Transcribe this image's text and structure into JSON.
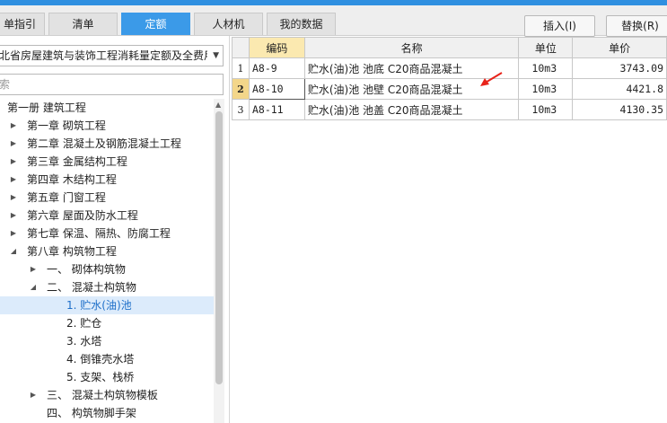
{
  "tabs": [
    {
      "label": "单指引",
      "active": false
    },
    {
      "label": "清单",
      "active": false
    },
    {
      "label": "定额",
      "active": true
    },
    {
      "label": "人材机",
      "active": false
    },
    {
      "label": "我的数据",
      "active": false
    }
  ],
  "toolbar": {
    "insert_label": "插入(I)",
    "replace_label": "替换(R)"
  },
  "library_select": {
    "value": "北省房屋建筑与装饰工程消耗量定额及全费用"
  },
  "search": {
    "placeholder": "索"
  },
  "tree": [
    {
      "label": "第一册 建筑工程",
      "indent": 0,
      "arrow": "",
      "selected": false
    },
    {
      "label": "第一章 砌筑工程",
      "indent": 1,
      "arrow": "▶",
      "selected": false
    },
    {
      "label": "第二章 混凝土及钢筋混凝土工程",
      "indent": 1,
      "arrow": "▶",
      "selected": false
    },
    {
      "label": "第三章 金属结构工程",
      "indent": 1,
      "arrow": "▶",
      "selected": false
    },
    {
      "label": "第四章 木结构工程",
      "indent": 1,
      "arrow": "▶",
      "selected": false
    },
    {
      "label": "第五章 门窗工程",
      "indent": 1,
      "arrow": "▶",
      "selected": false
    },
    {
      "label": "第六章 屋面及防水工程",
      "indent": 1,
      "arrow": "▶",
      "selected": false
    },
    {
      "label": "第七章 保温、隔热、防腐工程",
      "indent": 1,
      "arrow": "▶",
      "selected": false
    },
    {
      "label": "第八章 构筑物工程",
      "indent": 1,
      "arrow": "◢",
      "selected": false
    },
    {
      "label": "一、 砌体构筑物",
      "indent": 2,
      "arrow": "▶",
      "selected": false
    },
    {
      "label": "二、 混凝土构筑物",
      "indent": 2,
      "arrow": "◢",
      "selected": false
    },
    {
      "label": "1. 贮水(油)池",
      "indent": 3,
      "arrow": "",
      "selected": true
    },
    {
      "label": "2. 贮仓",
      "indent": 3,
      "arrow": "",
      "selected": false
    },
    {
      "label": "3. 水塔",
      "indent": 3,
      "arrow": "",
      "selected": false
    },
    {
      "label": "4. 倒锥壳水塔",
      "indent": 3,
      "arrow": "",
      "selected": false
    },
    {
      "label": "5. 支架、栈桥",
      "indent": 3,
      "arrow": "",
      "selected": false
    },
    {
      "label": "三、 混凝土构筑物模板",
      "indent": 2,
      "arrow": "▶",
      "selected": false
    },
    {
      "label": "四、 构筑物脚手架",
      "indent": 2,
      "arrow": "",
      "selected": false
    }
  ],
  "grid": {
    "headers": {
      "code": "编码",
      "name": "名称",
      "unit": "单位",
      "price": "单价"
    },
    "rows": [
      {
        "no": "1",
        "code": "A8-9",
        "name": "贮水(油)池 池底 C20商品混凝土",
        "unit": "10m3",
        "price": "3743.09"
      },
      {
        "no": "2",
        "code": "A8-10",
        "name": "贮水(油)池 池壁 C20商品混凝土",
        "unit": "10m3",
        "price": "4421.8"
      },
      {
        "no": "3",
        "code": "A8-11",
        "name": "贮水(油)池 池盖 C20商品混凝土",
        "unit": "10m3",
        "price": "4130.35"
      }
    ],
    "current_row": 2
  },
  "colors": {
    "accent": "#3b9ae8",
    "selected_row": "#f3d68a",
    "code_header": "#fbe9b0",
    "annotation": "#e8231a"
  }
}
